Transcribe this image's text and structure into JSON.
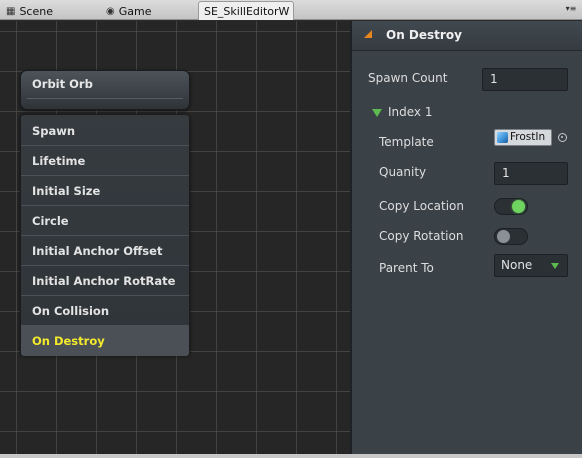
{
  "tabs": [
    {
      "label": "Scene",
      "icon": "scene-icon"
    },
    {
      "label": "Game",
      "icon": "game-icon"
    },
    {
      "label": "SE_SkillEditorW",
      "active": true
    }
  ],
  "node": {
    "title": "Orbit Orb",
    "items": [
      "Spawn",
      "Lifetime",
      "Initial Size",
      "Circle",
      "Initial Anchor Offset",
      "Initial Anchor RotRate",
      "On Collision",
      "On Destroy"
    ],
    "active_item": "On Destroy"
  },
  "inspector": {
    "title": "On Destroy",
    "spawn_count_label": "Spawn Count",
    "spawn_count_value": "1",
    "index_label": "Index 1",
    "template_label": "Template",
    "template_value": "FrostIn",
    "quantity_label": "Quanity",
    "quantity_value": "1",
    "copy_location_label": "Copy Location",
    "copy_location_on": true,
    "copy_rotation_label": "Copy Rotation",
    "copy_rotation_on": false,
    "parent_to_label": "Parent To",
    "parent_to_value": "None"
  },
  "colors": {
    "accent_yellow": "#f3ea2c",
    "toggle_on": "#6ed35f",
    "header_triangle": "#e8861e"
  }
}
